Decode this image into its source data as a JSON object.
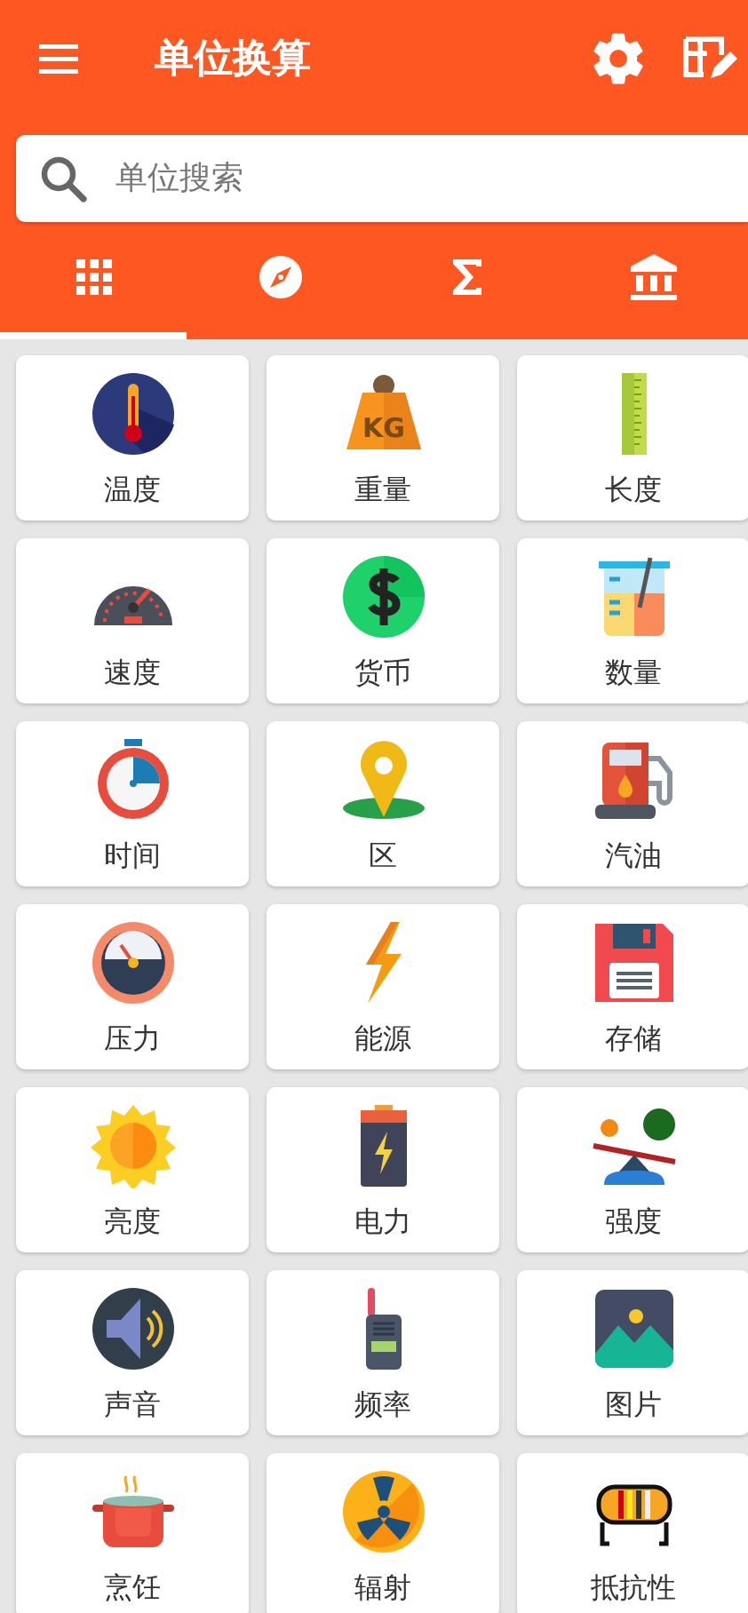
{
  "app_bar": {
    "title": "单位换算"
  },
  "search": {
    "placeholder": "单位搜索"
  },
  "tabs": [
    {
      "selected": true
    },
    {
      "selected": false
    },
    {
      "selected": false
    },
    {
      "selected": false
    }
  ],
  "categories": [
    {
      "label": "温度"
    },
    {
      "label": "重量"
    },
    {
      "label": "长度"
    },
    {
      "label": "速度"
    },
    {
      "label": "货币"
    },
    {
      "label": "数量"
    },
    {
      "label": "时间"
    },
    {
      "label": "区"
    },
    {
      "label": "汽油"
    },
    {
      "label": "压力"
    },
    {
      "label": "能源"
    },
    {
      "label": "存储"
    },
    {
      "label": "亮度"
    },
    {
      "label": "电力"
    },
    {
      "label": "强度"
    },
    {
      "label": "声音"
    },
    {
      "label": "频率"
    },
    {
      "label": "图片"
    },
    {
      "label": "烹饪"
    },
    {
      "label": "辐射"
    },
    {
      "label": "抵抗性"
    }
  ],
  "weight_icon": {
    "text": "KG"
  }
}
